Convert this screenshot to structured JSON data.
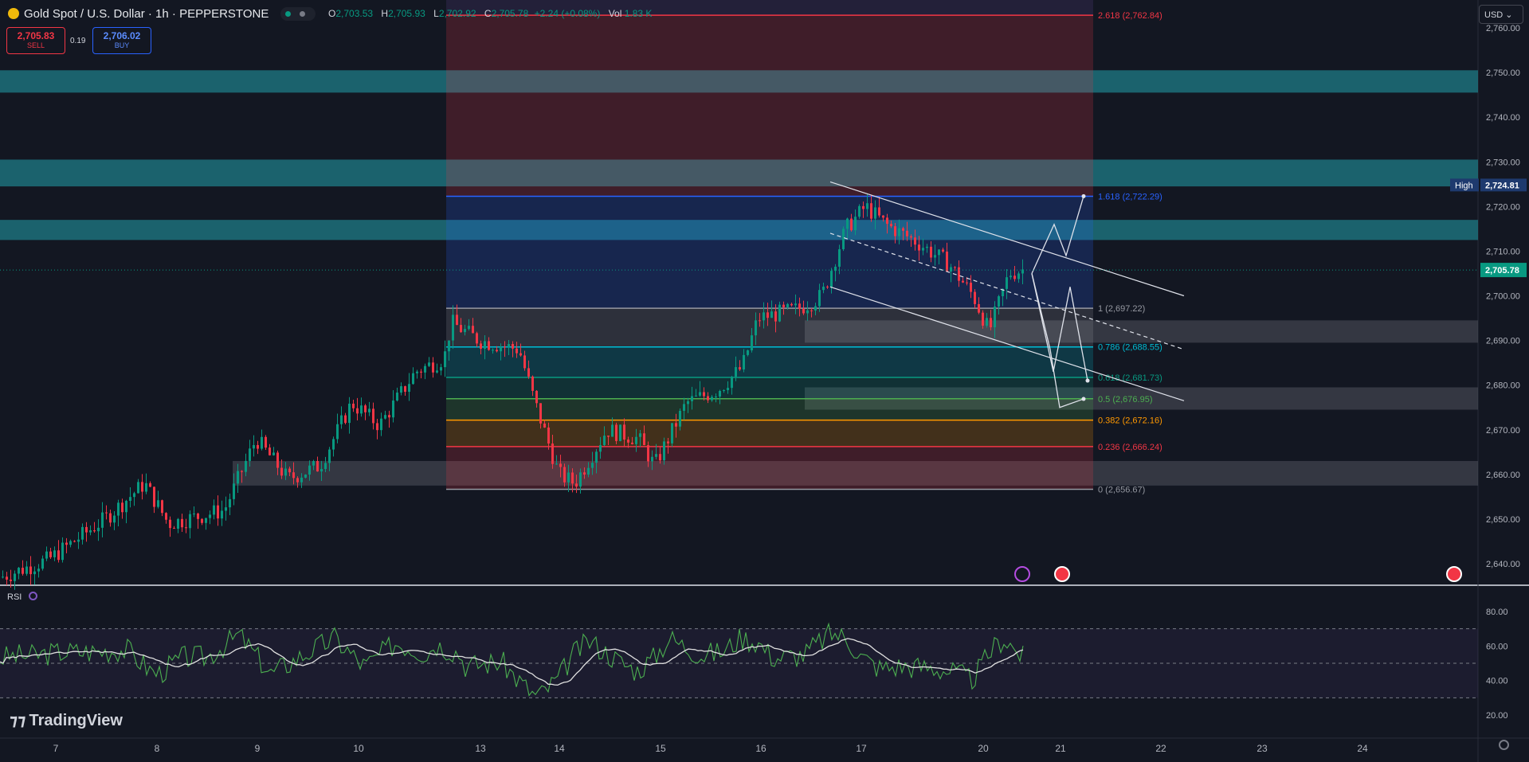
{
  "header": {
    "symbol": "Gold Spot / U.S. Dollar · 1h · PEPPERSTONE",
    "o_label": "O",
    "o_value": "2,703.53",
    "h_label": "H",
    "h_value": "2,705.93",
    "l_label": "L",
    "l_value": "2,702.92",
    "c_label": "C",
    "c_value": "2,705.78",
    "change": "+2.24 (+0.08%)",
    "vol_label": "Vol",
    "vol_value": "1.83 K"
  },
  "trade": {
    "sell_price": "2,705.83",
    "sell_label": "SELL",
    "spread": "0.19",
    "buy_price": "2,706.02",
    "buy_label": "BUY"
  },
  "currency": "USD",
  "indicator": {
    "label": "RSI"
  },
  "branding": {
    "logo_text": "TradingView"
  },
  "colors": {
    "background": "#131722",
    "up": "#089981",
    "down": "#f23645",
    "rsi_line": "#4caf50",
    "rsi_ma": "#e0e0e0"
  },
  "chart_data": {
    "type": "candlestick",
    "x_labels": [
      "7",
      "8",
      "9",
      "10",
      "13",
      "14",
      "15",
      "16",
      "17",
      "20",
      "21",
      "22",
      "23",
      "24"
    ],
    "price_axis": [
      "2,760.00",
      "2,750.00",
      "2,740.00",
      "2,730.00",
      "2,720.00",
      "2,710.00",
      "2,700.00",
      "2,690.00",
      "2,680.00",
      "2,670.00",
      "2,660.00",
      "2,650.00",
      "2,640.00"
    ],
    "price_range": [
      2635,
      2765
    ],
    "last_price": {
      "value": 2705.78,
      "label": "2,705.78"
    },
    "high_marker": {
      "label": "High",
      "value": 2724.81,
      "value_label": "2,724.81"
    },
    "fib_levels": [
      {
        "ratio": "2.618",
        "value": 2762.84,
        "label": "2.618 (2,762.84)",
        "color": "#f23645"
      },
      {
        "ratio": "1.618",
        "value": 2722.29,
        "label": "1.618 (2,722.29)",
        "color": "#2962ff"
      },
      {
        "ratio": "1",
        "value": 2697.22,
        "label": "1 (2,697.22)",
        "color": "#9598a1"
      },
      {
        "ratio": "0.786",
        "value": 2688.55,
        "label": "0.786 (2,688.55)",
        "color": "#00bcd4"
      },
      {
        "ratio": "0.618",
        "value": 2681.73,
        "label": "0.618 (2,681.73)",
        "color": "#089981"
      },
      {
        "ratio": "0.5",
        "value": 2676.95,
        "label": "0.5 (2,676.95)",
        "color": "#4caf50"
      },
      {
        "ratio": "0.382",
        "value": 2672.16,
        "label": "0.382 (2,672.16)",
        "color": "#ff9800"
      },
      {
        "ratio": "0.236",
        "value": 2666.24,
        "label": "0.236 (2,666.24)",
        "color": "#f23645"
      },
      {
        "ratio": "0",
        "value": 2656.67,
        "label": "0 (2,656.67)",
        "color": "#9598a1"
      }
    ],
    "zones": [
      {
        "from": 2745.5,
        "to": 2750.5,
        "color": "teal"
      },
      {
        "from": 2724.5,
        "to": 2730.5,
        "color": "teal"
      },
      {
        "from": 2712.5,
        "to": 2717.0,
        "color": "teal"
      },
      {
        "from": 2689.5,
        "to": 2694.5,
        "color": "grey"
      },
      {
        "from": 2674.5,
        "to": 2679.5,
        "color": "grey"
      },
      {
        "from": 2657.5,
        "to": 2663.0,
        "color": "grey"
      }
    ],
    "channel": {
      "upper": [
        [
          2725.5,
          2700.0
        ]
      ],
      "mid": [
        [
          2714.0,
          2688.0
        ]
      ],
      "lower": [
        [
          2702.0,
          2676.5
        ]
      ]
    },
    "projection_path": [
      2705,
      2683,
      2702,
      2675,
      2688,
      2681,
      2707,
      2692,
      2716,
      2709,
      2722
    ],
    "rsi": {
      "axis": [
        "80.00",
        "60.00",
        "40.00",
        "20.00"
      ],
      "range": [
        20,
        85
      ],
      "levels": [
        70,
        50,
        30
      ]
    }
  }
}
